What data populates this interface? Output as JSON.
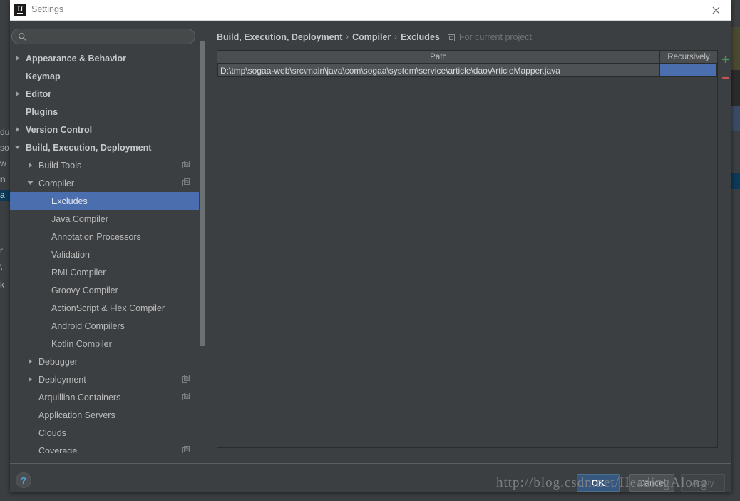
{
  "window": {
    "title": "Settings",
    "logo_icon": "intellij-idea-logo-icon",
    "close_icon": "close-icon"
  },
  "sidebar": {
    "search": {
      "value": "",
      "placeholder": "",
      "icon": "search-icon"
    },
    "tree": [
      {
        "label": "Appearance & Behavior",
        "indent": 0,
        "arrow": "collapsed",
        "bold": true,
        "selected": false,
        "modicon": false
      },
      {
        "label": "Keymap",
        "indent": 0,
        "arrow": "none",
        "bold": true,
        "selected": false,
        "modicon": false
      },
      {
        "label": "Editor",
        "indent": 0,
        "arrow": "collapsed",
        "bold": true,
        "selected": false,
        "modicon": false
      },
      {
        "label": "Plugins",
        "indent": 0,
        "arrow": "none",
        "bold": true,
        "selected": false,
        "modicon": false
      },
      {
        "label": "Version Control",
        "indent": 0,
        "arrow": "collapsed",
        "bold": true,
        "selected": false,
        "modicon": false
      },
      {
        "label": "Build, Execution, Deployment",
        "indent": 0,
        "arrow": "expanded",
        "bold": true,
        "selected": false,
        "modicon": false
      },
      {
        "label": "Build Tools",
        "indent": 1,
        "arrow": "collapsed",
        "bold": false,
        "selected": false,
        "modicon": true
      },
      {
        "label": "Compiler",
        "indent": 1,
        "arrow": "expanded",
        "bold": false,
        "selected": false,
        "modicon": true
      },
      {
        "label": "Excludes",
        "indent": 2,
        "arrow": "none",
        "bold": false,
        "selected": true,
        "modicon": false
      },
      {
        "label": "Java Compiler",
        "indent": 2,
        "arrow": "none",
        "bold": false,
        "selected": false,
        "modicon": false
      },
      {
        "label": "Annotation Processors",
        "indent": 2,
        "arrow": "none",
        "bold": false,
        "selected": false,
        "modicon": false
      },
      {
        "label": "Validation",
        "indent": 2,
        "arrow": "none",
        "bold": false,
        "selected": false,
        "modicon": false
      },
      {
        "label": "RMI Compiler",
        "indent": 2,
        "arrow": "none",
        "bold": false,
        "selected": false,
        "modicon": false
      },
      {
        "label": "Groovy Compiler",
        "indent": 2,
        "arrow": "none",
        "bold": false,
        "selected": false,
        "modicon": false
      },
      {
        "label": "ActionScript & Flex Compiler",
        "indent": 2,
        "arrow": "none",
        "bold": false,
        "selected": false,
        "modicon": false
      },
      {
        "label": "Android Compilers",
        "indent": 2,
        "arrow": "none",
        "bold": false,
        "selected": false,
        "modicon": false
      },
      {
        "label": "Kotlin Compiler",
        "indent": 2,
        "arrow": "none",
        "bold": false,
        "selected": false,
        "modicon": false
      },
      {
        "label": "Debugger",
        "indent": 1,
        "arrow": "collapsed",
        "bold": false,
        "selected": false,
        "modicon": false
      },
      {
        "label": "Deployment",
        "indent": 1,
        "arrow": "collapsed",
        "bold": false,
        "selected": false,
        "modicon": true
      },
      {
        "label": "Arquillian Containers",
        "indent": 1,
        "arrow": "none",
        "bold": false,
        "selected": false,
        "modicon": true
      },
      {
        "label": "Application Servers",
        "indent": 1,
        "arrow": "none",
        "bold": false,
        "selected": false,
        "modicon": false
      },
      {
        "label": "Clouds",
        "indent": 1,
        "arrow": "none",
        "bold": false,
        "selected": false,
        "modicon": false
      },
      {
        "label": "Coverage",
        "indent": 1,
        "arrow": "none",
        "bold": false,
        "selected": false,
        "modicon": true
      }
    ]
  },
  "breadcrumb": {
    "crumbs": [
      "Build, Execution, Deployment",
      "Compiler",
      "Excludes"
    ],
    "separator": "›",
    "scope_icon": "project-scope-icon",
    "scope_label": "For current project"
  },
  "table": {
    "columns": [
      "Path",
      "Recursively"
    ],
    "rows": [
      {
        "path": "D:\\tmp\\sogaa-web\\src\\main\\java\\com\\sogaa\\system\\service\\article\\dao\\ArticleMapper.java",
        "recursively": ""
      }
    ]
  },
  "toolbar": {
    "add_label": "+",
    "add_icon": "plus-icon",
    "remove_label": "−",
    "remove_icon": "minus-icon"
  },
  "footer": {
    "help_label": "?",
    "ok_label": "OK",
    "cancel_label": "Cancel",
    "apply_label": "Apply"
  },
  "watermark": {
    "text": "http://blog.csdn.net/HeadingAlong"
  },
  "background": {
    "left_fragments": [
      "du",
      "so",
      "w",
      "n",
      "a",
      "",
      "r",
      "\\",
      "k"
    ],
    "right_strips": [
      "#4a4a32",
      "#2b2b2b",
      "#3b4a63",
      "#0d3a58"
    ]
  },
  "colors": {
    "accent_selection": "#4b6eaf",
    "dialog_bg": "#3c3f41",
    "ok_button": "#365880",
    "add_icon": "#499c54",
    "remove_icon": "#c75450",
    "help_icon": "#4aa5d8"
  }
}
